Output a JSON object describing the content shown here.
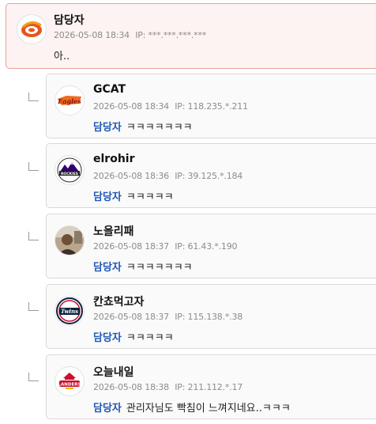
{
  "main_comment": {
    "author": "담당자",
    "date": "2026-05-08 18:34",
    "ip": "IP: ***.***.***.***",
    "text": "아.."
  },
  "replies": [
    {
      "author": "GCAT",
      "date": "2026-05-08 18:34",
      "ip": "IP: 118.235.*.211",
      "mention": "담당자",
      "text": "ㅋㅋㅋㅋㅋㅋㅋ"
    },
    {
      "author": "elrohir",
      "date": "2026-05-08 18:36",
      "ip": "IP: 39.125.*.184",
      "mention": "담당자",
      "text": "ㅋㅋㅋㅋㅋ"
    },
    {
      "author": "노을리패",
      "date": "2026-05-08 18:37",
      "ip": "IP: 61.43.*.190",
      "mention": "담당자",
      "text": "ㅋㅋㅋㅋㅋㅋㅋ"
    },
    {
      "author": "칸쵸먹고자",
      "date": "2026-05-08 18:37",
      "ip": "IP: 115.138.*.38",
      "mention": "담당자",
      "text": "ㅋㅋㅋㅋㅋ"
    },
    {
      "author": "오늘내일",
      "date": "2026-05-08 18:38",
      "ip": "IP: 211.112.*.17",
      "mention": "담당자",
      "text": "관리자님도 빡침이 느껴지네요..ㅋㅋㅋ"
    }
  ],
  "logo_text": {
    "eagles": "Eagles",
    "rockies": "ROCKIES",
    "twins": "Twins",
    "landers": "LANDERS"
  },
  "colors": {
    "mention": "#1f57b5",
    "main_border": "#e8a0a0",
    "main_bg": "#fdf3f3"
  }
}
